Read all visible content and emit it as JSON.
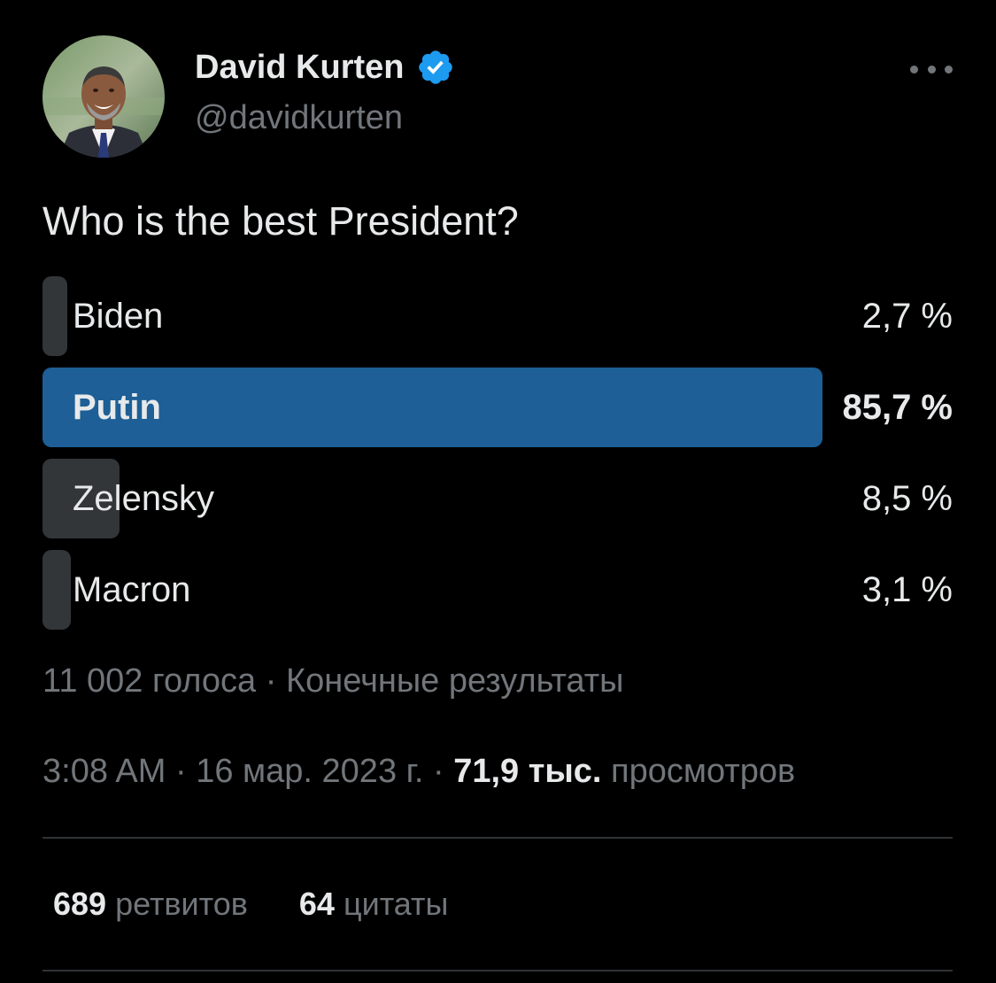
{
  "author": {
    "display_name": "David Kurten",
    "handle": "@davidkurten",
    "verified": true,
    "verified_color": "#1d9bf0"
  },
  "tweet": {
    "text": "Who is the best President?"
  },
  "poll": {
    "options": [
      {
        "label": "Biden",
        "percent_text": "2,7 %",
        "percent": 2.7,
        "winner": false
      },
      {
        "label": "Putin",
        "percent_text": "85,7 %",
        "percent": 85.7,
        "winner": true
      },
      {
        "label": "Zelensky",
        "percent_text": "8,5 %",
        "percent": 8.5,
        "winner": false
      },
      {
        "label": "Macron",
        "percent_text": "3,1 %",
        "percent": 3.1,
        "winner": false
      }
    ],
    "votes_text": "11 002 голоса",
    "separator": "·",
    "status_text": "Конечные результаты",
    "winner_color": "#1d5f96",
    "bar_color": "#333639"
  },
  "meta": {
    "time": "3:08 AM",
    "date": "16 мар. 2023 г.",
    "views_count": "71,9 тыс.",
    "views_label": "просмотров"
  },
  "stats": {
    "retweets_count": "689",
    "retweets_label": "ретвитов",
    "quotes_count": "64",
    "quotes_label": "цитаты"
  }
}
